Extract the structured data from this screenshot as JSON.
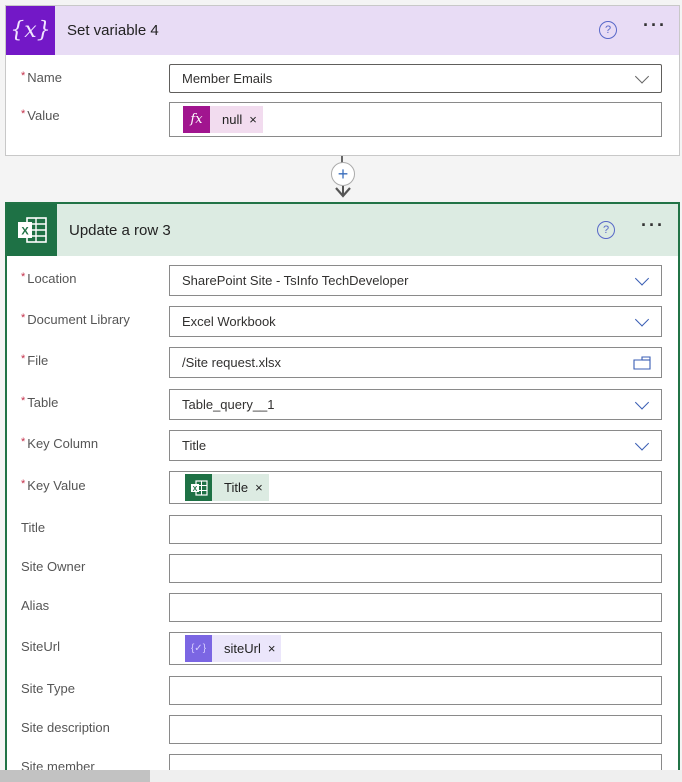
{
  "set_variable": {
    "title": "Set variable 4",
    "icon": "variable-icon",
    "icon_glyph": "{x}",
    "help_glyph": "?",
    "more_glyph": "···",
    "fields": [
      {
        "label": "Name",
        "required": true,
        "value": "Member Emails",
        "type": "dropdown"
      },
      {
        "label": "Value",
        "required": true,
        "type": "token",
        "token": {
          "icon": "fx-icon",
          "icon_glyph": "fx",
          "label": "null",
          "close": "×"
        }
      }
    ]
  },
  "connector": {
    "plus_glyph": "+"
  },
  "update_row": {
    "title": "Update a row 3",
    "icon": "excel-icon",
    "help_glyph": "?",
    "more_glyph": "···",
    "fields": [
      {
        "label": "Location",
        "required": true,
        "value": "SharePoint Site - TsInfo TechDeveloper",
        "type": "dropdown"
      },
      {
        "label": "Document Library",
        "required": true,
        "value": "Excel Workbook",
        "type": "dropdown"
      },
      {
        "label": "File",
        "required": true,
        "value": "/Site request.xlsx",
        "type": "file"
      },
      {
        "label": "Table",
        "required": true,
        "value": "Table_query__1",
        "type": "dropdown"
      },
      {
        "label": "Key Column",
        "required": true,
        "value": "Title",
        "type": "dropdown"
      },
      {
        "label": "Key Value",
        "required": true,
        "type": "token",
        "token": {
          "icon": "excel-icon",
          "label": "Title",
          "close": "×"
        }
      },
      {
        "label": "Title",
        "required": false,
        "value": "",
        "type": "text"
      },
      {
        "label": "Site Owner",
        "required": false,
        "value": "",
        "type": "text"
      },
      {
        "label": "Alias",
        "required": false,
        "value": "",
        "type": "text"
      },
      {
        "label": "SiteUrl",
        "required": false,
        "type": "token",
        "token": {
          "icon": "variable-icon",
          "icon_glyph": "{✓}",
          "label": "siteUrl",
          "close": "×"
        }
      },
      {
        "label": "Site Type",
        "required": false,
        "value": "",
        "type": "text"
      },
      {
        "label": "Site description",
        "required": false,
        "value": "",
        "type": "text"
      },
      {
        "label": "Site member",
        "required": false,
        "value": "",
        "type": "text"
      }
    ]
  },
  "required_marker": "*",
  "colors": {
    "variable_accent": "#7318c7",
    "variable_header": "#e8dcf5",
    "excel_accent": "#1e7145",
    "excel_header": "#dcebe2",
    "fx_token": "#a1158f",
    "var_token": "#7b66e3",
    "required": "#c4314b",
    "link_blue": "#3a5eb4"
  }
}
